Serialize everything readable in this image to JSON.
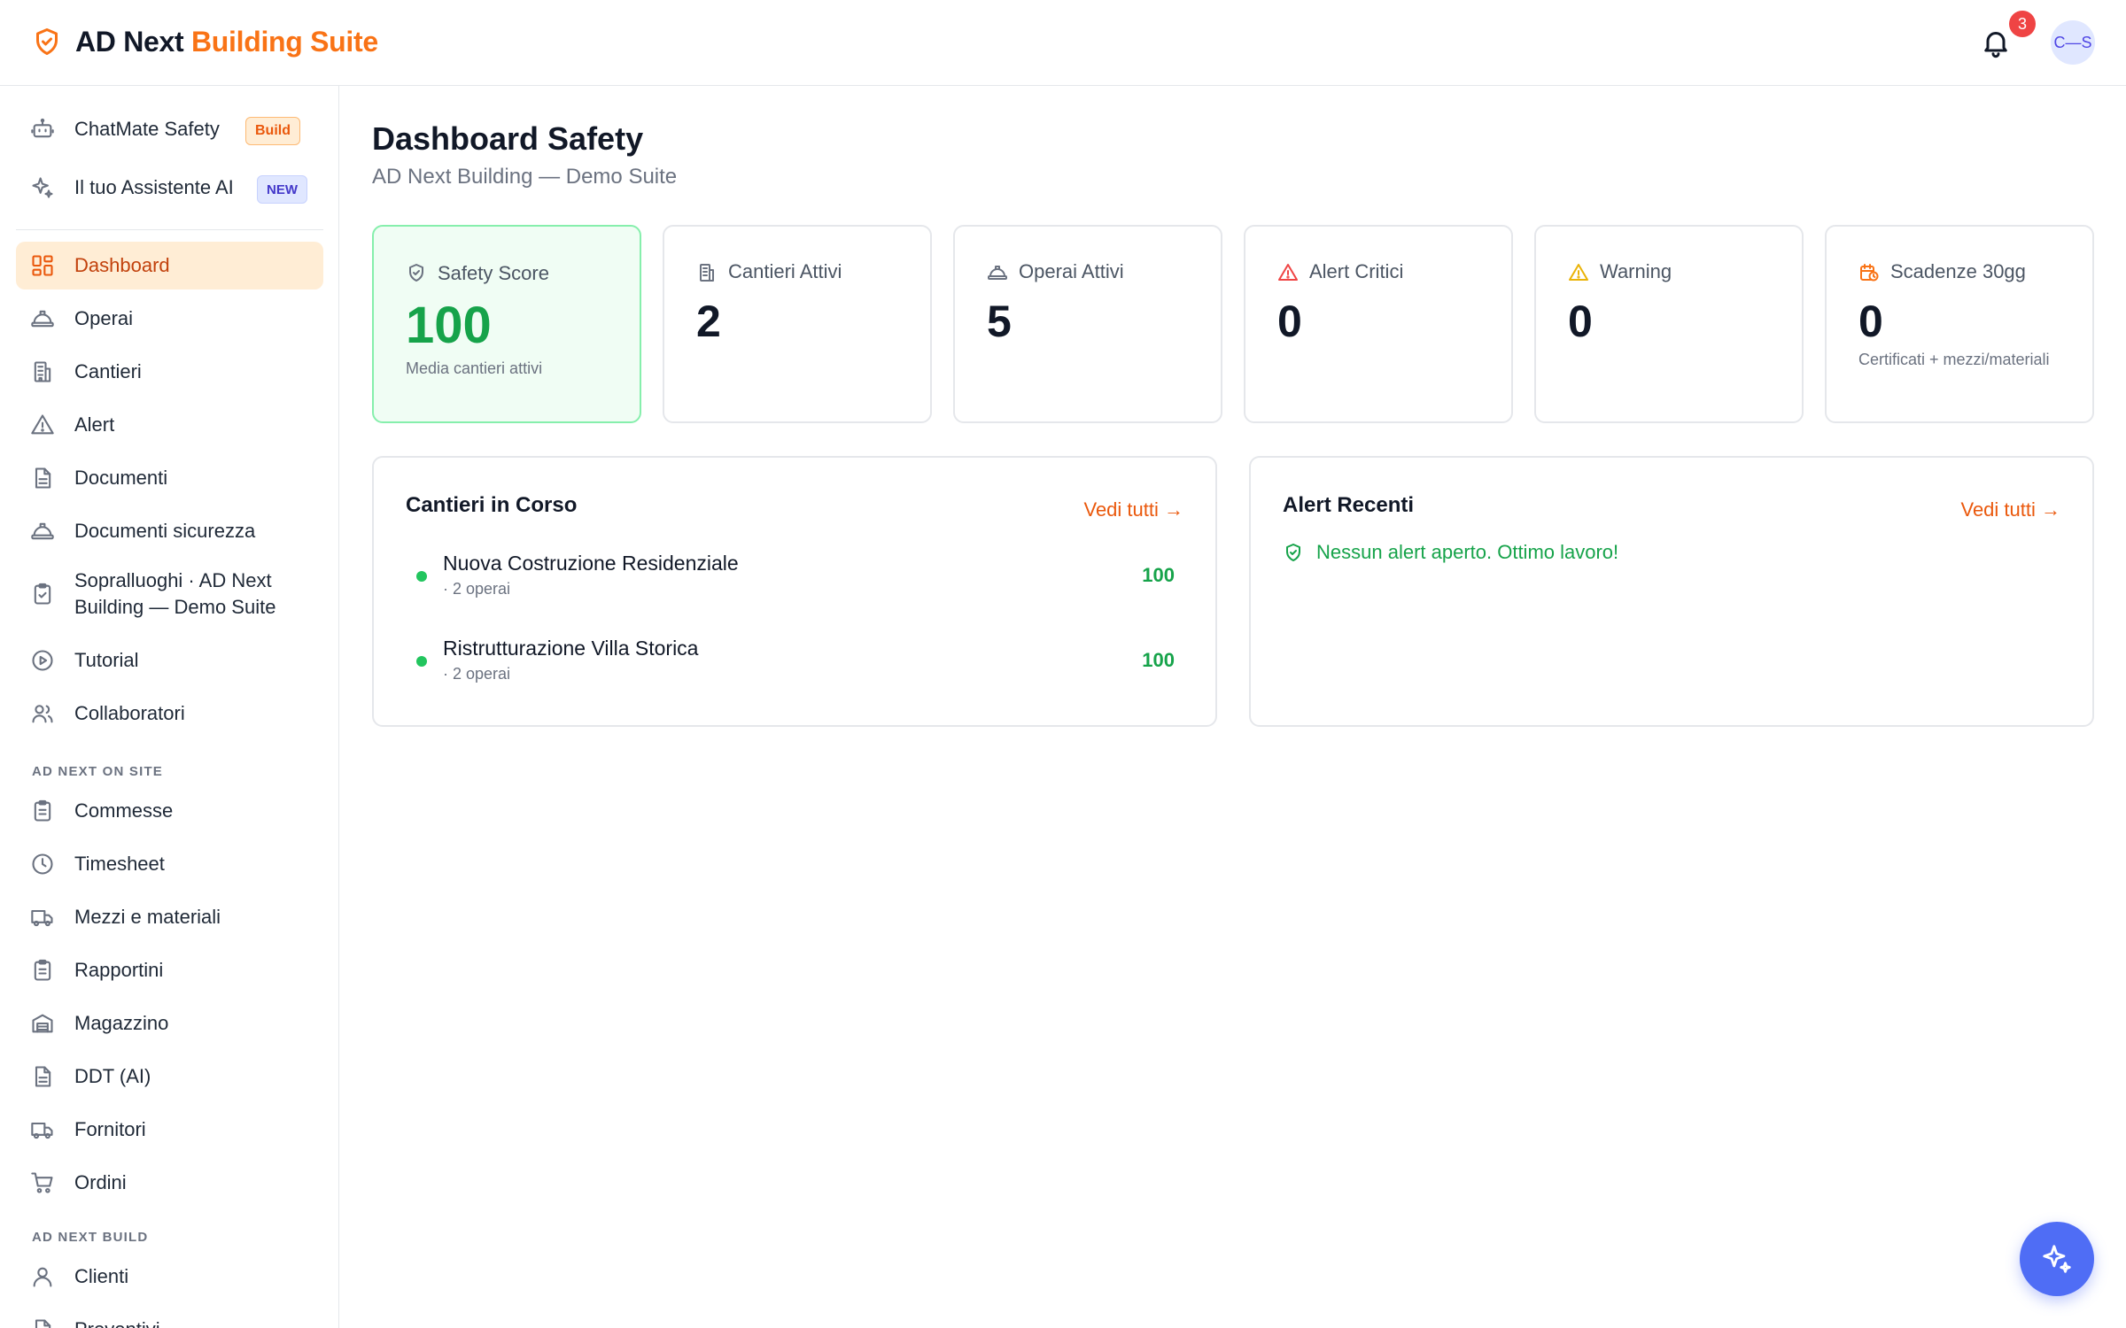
{
  "header": {
    "brand_part1": "AD Next",
    "brand_part2": "Building Suite",
    "notification_count": "3",
    "avatar_initials": "C—S"
  },
  "sidebar": {
    "top_items": [
      {
        "label": "ChatMate Safety",
        "tag": "Build",
        "icon": "robot-icon"
      },
      {
        "label": "Il tuo Assistente AI",
        "tag": "NEW",
        "icon": "sparkles-icon"
      }
    ],
    "items": [
      {
        "label": "Dashboard",
        "icon": "dashboard-icon",
        "active": true
      },
      {
        "label": "Operai",
        "icon": "hardhat-icon"
      },
      {
        "label": "Cantieri",
        "icon": "building-icon"
      },
      {
        "label": "Alert",
        "icon": "warning-icon"
      },
      {
        "label": "Documenti",
        "icon": "document-icon"
      },
      {
        "label": "Documenti sicurezza",
        "icon": "hardhat-icon"
      },
      {
        "label": "Sopralluoghi · AD Next Building — Demo Suite",
        "icon": "clipboard-check-icon"
      },
      {
        "label": "Tutorial",
        "icon": "play-circle-icon"
      },
      {
        "label": "Collaboratori",
        "icon": "users-icon"
      }
    ],
    "section_onsite": "AD NEXT ON SITE",
    "onsite_items": [
      {
        "label": "Commesse",
        "icon": "clipboard-list-icon"
      },
      {
        "label": "Timesheet",
        "icon": "clock-icon"
      },
      {
        "label": "Mezzi e materiali",
        "icon": "truck-icon"
      },
      {
        "label": "Rapportini",
        "icon": "clipboard-list-icon"
      },
      {
        "label": "Magazzino",
        "icon": "warehouse-icon"
      },
      {
        "label": "DDT (AI)",
        "icon": "document-icon"
      },
      {
        "label": "Fornitori",
        "icon": "truck-icon"
      },
      {
        "label": "Ordini",
        "icon": "cart-icon"
      }
    ],
    "section_build": "AD NEXT BUILD",
    "build_items": [
      {
        "label": "Clienti",
        "icon": "user-icon"
      },
      {
        "label": "Preventivi",
        "icon": "document-icon"
      }
    ]
  },
  "page": {
    "title": "Dashboard Safety",
    "subtitle": "AD Next Building — Demo Suite"
  },
  "stats": [
    {
      "label": "Safety Score",
      "value": "100",
      "note": "Media cantieri attivi",
      "icon": "shield-check-icon",
      "color": "#16a34a"
    },
    {
      "label": "Cantieri Attivi",
      "value": "2",
      "note": "",
      "icon": "building-icon",
      "color": "#6b7280"
    },
    {
      "label": "Operai Attivi",
      "value": "5",
      "note": "",
      "icon": "hardhat-icon",
      "color": "#6b7280"
    },
    {
      "label": "Alert Critici",
      "value": "0",
      "note": "",
      "icon": "alert-triangle-icon",
      "color": "#ef4444"
    },
    {
      "label": "Warning",
      "value": "0",
      "note": "",
      "icon": "warning-icon",
      "color": "#eab308"
    },
    {
      "label": "Scadenze 30gg",
      "value": "0",
      "note": "Certificati + mezzi/materiali",
      "icon": "calendar-clock-icon",
      "color": "#f97316"
    }
  ],
  "cantieri_panel": {
    "title": "Cantieri in Corso",
    "link": "Vedi tutti →",
    "rows": [
      {
        "name": "Nuova Costruzione Residenziale",
        "meta": "· 2 operai",
        "score": "100"
      },
      {
        "name": "Ristrutturazione Villa Storica",
        "meta": "· 2 operai",
        "score": "100"
      }
    ]
  },
  "alert_panel": {
    "title": "Alert Recenti",
    "link": "Vedi tutti →",
    "empty_message": "Nessun alert aperto. Ottimo lavoro!"
  },
  "colors": {
    "accent": "#f97316",
    "success": "#16a34a",
    "fab": "#4f6df5"
  }
}
